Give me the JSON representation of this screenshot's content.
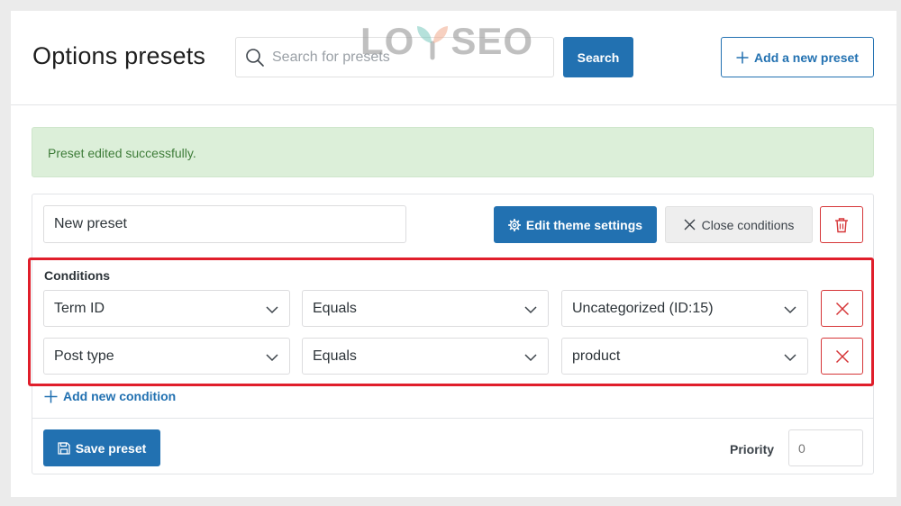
{
  "header": {
    "title": "Options presets",
    "search_placeholder": "Search for presets",
    "search_label": "Search",
    "add_label": "Add a new preset"
  },
  "notice": {
    "text": "Preset edited successfully."
  },
  "preset": {
    "name": "New preset",
    "edit_theme_label": "Edit theme settings",
    "close_conditions_label": "Close conditions",
    "conditions_title": "Conditions",
    "conditions": [
      {
        "field": "Term ID",
        "operator": "Equals",
        "value": "Uncategorized (ID:15)"
      },
      {
        "field": "Post type",
        "operator": "Equals",
        "value": "product"
      }
    ],
    "add_condition_label": "Add new condition",
    "save_label": "Save preset",
    "priority_label": "Priority",
    "priority_placeholder": "0"
  },
  "watermark": {
    "left": "LO",
    "right": "SEO"
  },
  "colors": {
    "primary": "#2271b1",
    "danger": "#d63638",
    "success_bg": "#dcefd9",
    "highlight": "#e01e2b"
  }
}
